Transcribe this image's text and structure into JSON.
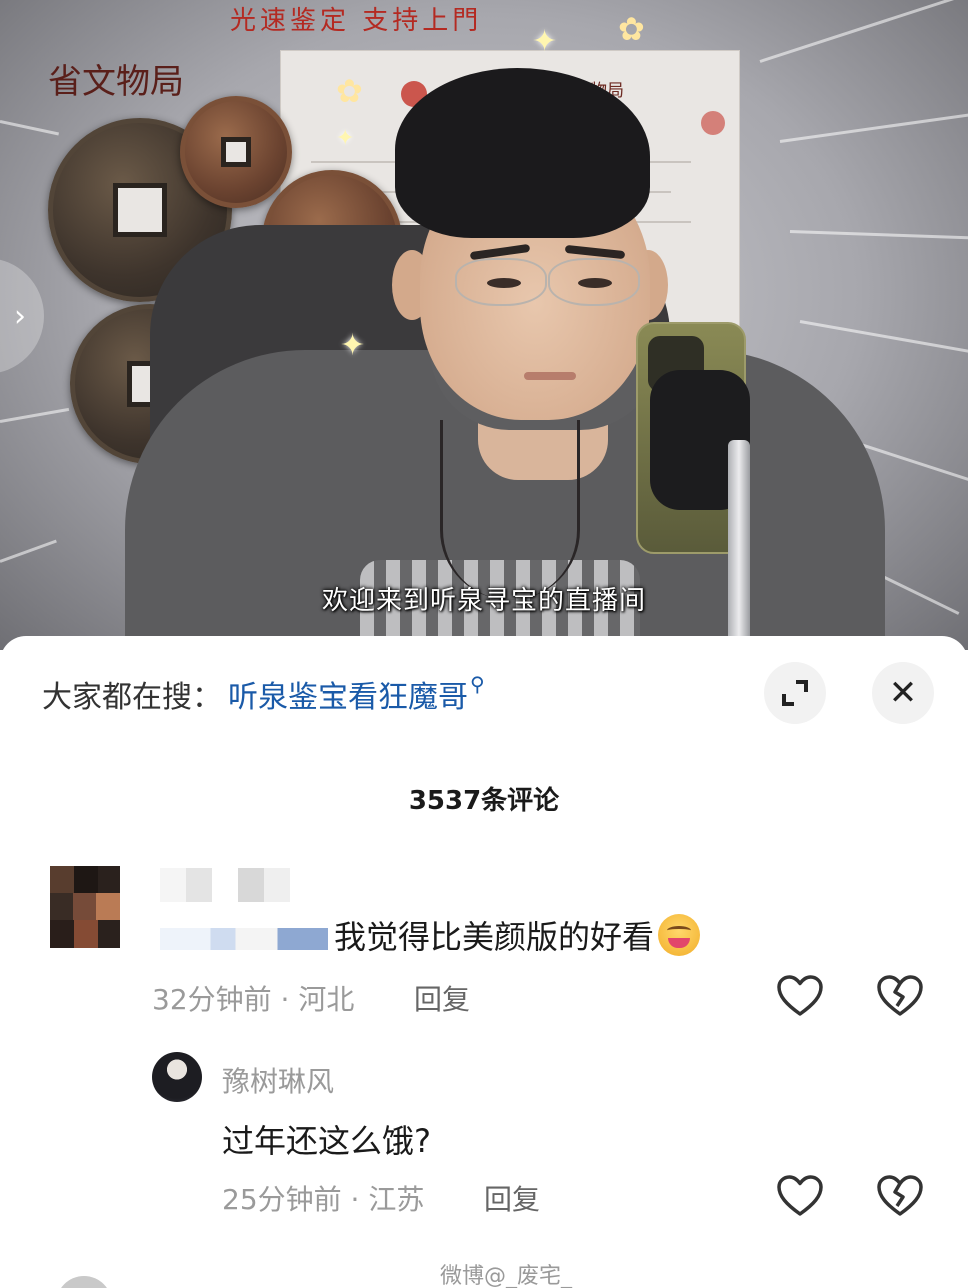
{
  "video": {
    "banner_text": "光速鉴定 支持上門",
    "wall_sign": "省文物局",
    "wall_sign_small": "省文物局",
    "caption": "欢迎来到听泉寻宝的直播间",
    "nav_arrow": "›"
  },
  "search_bar": {
    "label": "大家都在搜：",
    "query": "听泉鉴宝看狂魔哥",
    "search_glyph": "⚲"
  },
  "toolbar": {
    "expand_icon": "expand-icon",
    "close_glyph": "✕"
  },
  "comments_header": {
    "count_text": "3537条评论"
  },
  "comments": [
    {
      "author": "",
      "text": "我觉得比美颜版的好看",
      "emoji": "hungry-face-emoji",
      "time": "32分钟前 · 河北",
      "reply_label": "回复"
    },
    {
      "author": "豫树琳风",
      "text": "过年还这么饿?",
      "time": "25分钟前 · 江苏",
      "reply_label": "回复"
    }
  ],
  "watermark": "微博@_废宅_",
  "colors": {
    "link": "#1a5aa8",
    "meta": "#9a9a9a",
    "caption": "#ffffff"
  }
}
